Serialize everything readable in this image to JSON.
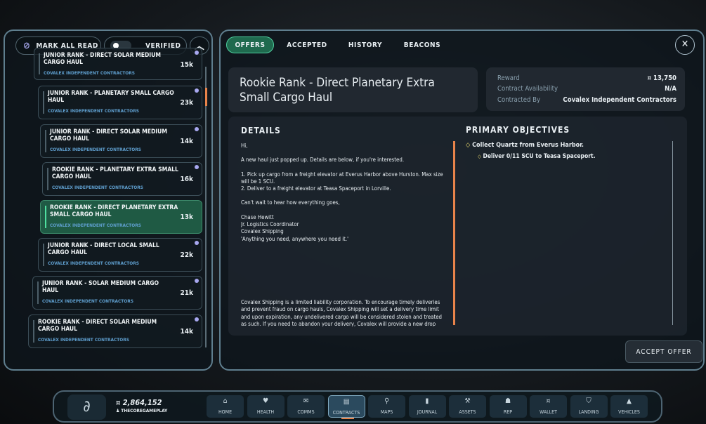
{
  "left": {
    "mark_all_read": "MARK ALL READ",
    "verified": "VERIFIED",
    "items": [
      {
        "title": "JUNIOR RANK - DIRECT SOLAR MEDIUM CARGO HAUL",
        "sub": "COVALEX INDEPENDENT CONTRACTORS",
        "value": "15k"
      },
      {
        "title": "JUNIOR RANK - PLANETARY SMALL CARGO HAUL",
        "sub": "COVALEX INDEPENDENT CONTRACTORS",
        "value": "23k"
      },
      {
        "title": "JUNIOR RANK - DIRECT SOLAR MEDIUM CARGO HAUL",
        "sub": "COVALEX INDEPENDENT CONTRACTORS",
        "value": "14k"
      },
      {
        "title": "ROOKIE RANK - PLANETARY EXTRA SMALL CARGO HAUL",
        "sub": "COVALEX INDEPENDENT CONTRACTORS",
        "value": "16k"
      },
      {
        "title": "ROOKIE RANK - DIRECT PLANETARY EXTRA SMALL CARGO HAUL",
        "sub": "COVALEX INDEPENDENT CONTRACTORS",
        "value": "13k"
      },
      {
        "title": "JUNIOR RANK - DIRECT LOCAL SMALL CARGO HAUL",
        "sub": "COVALEX INDEPENDENT CONTRACTORS",
        "value": "22k"
      },
      {
        "title": "JUNIOR RANK - SOLAR MEDIUM CARGO HAUL",
        "sub": "COVALEX INDEPENDENT CONTRACTORS",
        "value": "21k"
      },
      {
        "title": "ROOKIE RANK - DIRECT SOLAR MEDIUM CARGO HAUL",
        "sub": "COVALEX INDEPENDENT CONTRACTORS",
        "value": "14k"
      }
    ]
  },
  "tabs": [
    "OFFERS",
    "ACCEPTED",
    "HISTORY",
    "BEACONS"
  ],
  "contract": {
    "title": "Rookie Rank - Direct Planetary Extra Small Cargo Haul",
    "reward_label": "Reward",
    "reward": "¤ 13,750",
    "availability_label": "Contract Availability",
    "availability": "N/A",
    "contracted_by_label": "Contracted By",
    "contracted_by": "Covalex Independent Contractors",
    "details_heading": "DETAILS",
    "details": [
      "Hi,",
      "A new haul just popped up. Details are below, if you're interested.",
      "1. Pick up cargo from a freight elevator at Everus Harbor above Hurston. Max size will be 1 SCU.\n2. Deliver to a freight elevator at Teasa Spaceport in Lorville.",
      "Can't wait to hear how everything goes,",
      "Chase Hewitt\nJr. Logistics Coordinator\nCovalex Shipping\n'Anything you need, anywhere you need it.'",
      "Covalex Shipping is a limited liability corporation. To encourage timely deliveries and prevent fraud on cargo hauls, Covalex Shipping will set a delivery time limit and upon expiration, any undelivered cargo will be considered stolen and treated as such. If you need to abandon your delivery, Covalex will provide a new drop"
    ],
    "objectives_heading": "PRIMARY OBJECTIVES",
    "objective": "Collect Quartz from Everus Harbor.",
    "sub_objective": "Deliver 0/11 SCU to Teasa Spaceport.",
    "accept": "ACCEPT OFFER"
  },
  "bottom": {
    "balance": "2,864,152",
    "user": "THECOREGAMEPLAY",
    "nav": [
      {
        "label": "HOME",
        "icon": "home-icon",
        "glyph": "⌂"
      },
      {
        "label": "HEALTH",
        "icon": "heart-icon",
        "glyph": "♥"
      },
      {
        "label": "COMMS",
        "icon": "chat-icon",
        "glyph": "✉"
      },
      {
        "label": "CONTRACTS",
        "icon": "contracts-icon",
        "glyph": "▤"
      },
      {
        "label": "MAPS",
        "icon": "maps-icon",
        "glyph": "⚲"
      },
      {
        "label": "JOURNAL",
        "icon": "journal-icon",
        "glyph": "▮"
      },
      {
        "label": "ASSETS",
        "icon": "assets-icon",
        "glyph": "⚒"
      },
      {
        "label": "REP",
        "icon": "rep-icon",
        "glyph": "☗"
      },
      {
        "label": "WALLET",
        "icon": "wallet-icon",
        "glyph": "¤"
      },
      {
        "label": "LANDING",
        "icon": "landing-icon",
        "glyph": "⛉"
      },
      {
        "label": "VEHICLES",
        "icon": "vehicles-icon",
        "glyph": "▲"
      }
    ]
  },
  "colors": {
    "accent": "#e8834a",
    "selected": "#1f5a44",
    "link": "#5f9fcf"
  }
}
